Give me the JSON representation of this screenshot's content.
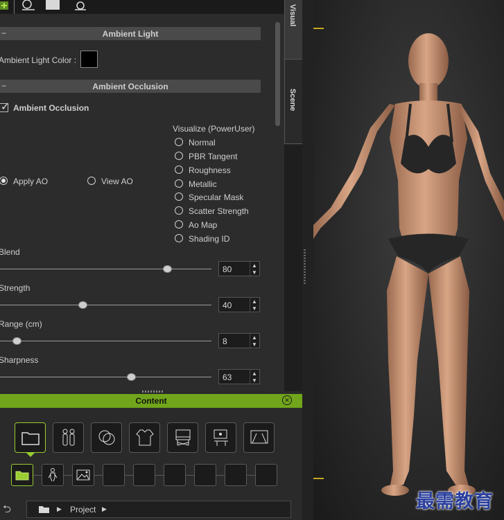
{
  "side_tabs": {
    "visual": "Visual",
    "scene": "Scene"
  },
  "ambient_light": {
    "header": "Ambient Light",
    "collapse_symbol": "−",
    "color_label": "Ambient Light Color :",
    "color": "#000000"
  },
  "ambient_occlusion": {
    "header": "Ambient Occlusion",
    "collapse_symbol": "−",
    "checkbox_label": "Ambient Occlusion",
    "checked": true,
    "mode_apply": "Apply AO",
    "mode_view": "View AO",
    "selected_mode": "Apply AO",
    "visualize_title": "Visualize (PowerUser)",
    "visualize_options": [
      "Normal",
      "PBR Tangent",
      "Roughness",
      "Metallic",
      "Specular Mask",
      "Scatter Strength",
      "Ao Map",
      "Shading ID"
    ],
    "sliders": {
      "blend": {
        "label": "Blend",
        "value": "80",
        "fraction": 0.79
      },
      "strength": {
        "label": "Strength",
        "value": "40",
        "fraction": 0.39
      },
      "range": {
        "label": "Range (cm)",
        "value": "8",
        "fraction": 0.08
      },
      "sharpness": {
        "label": "Sharpness",
        "value": "63",
        "fraction": 0.62
      }
    }
  },
  "content": {
    "title": "Content",
    "close_symbol": "✕",
    "categories": [
      "folder-icon",
      "characters-icon",
      "materials-icon",
      "clothing-icon",
      "props-icon",
      "scene-icon",
      "stage-icon"
    ],
    "path_label": "Project",
    "arrow_symbol": "▶",
    "back_symbol": "⮌"
  },
  "watermark": "最需教育",
  "colors": {
    "accent_green": "#71a51b",
    "panel_bg": "#2c2c2c"
  }
}
